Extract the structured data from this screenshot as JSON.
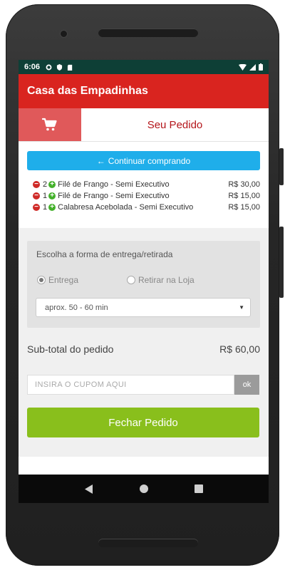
{
  "statusbar": {
    "time": "6:06"
  },
  "app": {
    "title": "Casa das Empadinhas"
  },
  "tabs": {
    "order_label": "Seu Pedido"
  },
  "continue_button": {
    "label": "Continuar comprando"
  },
  "items": [
    {
      "qty": "2",
      "name": "Filé de Frango - Semi Executivo",
      "price": "R$ 30,00"
    },
    {
      "qty": "1",
      "name": "Filé de Frango - Semi Executivo",
      "price": "R$ 15,00"
    },
    {
      "qty": "1",
      "name": "Calabresa Acebolada - Semi Executivo",
      "price": "R$ 15,00"
    }
  ],
  "delivery": {
    "title": "Escolha a forma de entrega/retirada",
    "option_delivery": "Entrega",
    "option_pickup": "Retirar na Loja",
    "selected": "Entrega",
    "time_select_value": "aprox. 50 - 60 min"
  },
  "subtotal": {
    "label": "Sub-total do pedido",
    "value": "R$ 60,00"
  },
  "coupon": {
    "placeholder": "INSIRA O CUPOM AQUI",
    "button": "ok"
  },
  "checkout_button": {
    "label": "Fechar Pedido"
  },
  "colors": {
    "primary": "#d9241f",
    "accent": "#1faeea",
    "checkout": "#89bf1c"
  }
}
